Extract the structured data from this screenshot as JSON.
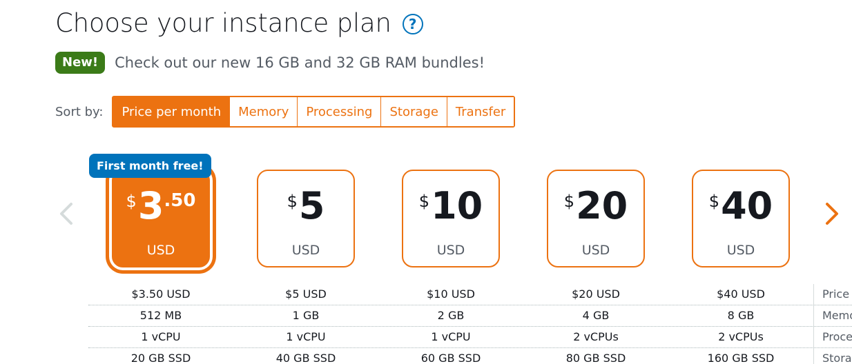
{
  "header": {
    "title": "Choose your instance plan",
    "help_icon": "question-circle-icon"
  },
  "announcement": {
    "badge": "New!",
    "text": "Check out our new 16 GB and 32 GB RAM bundles!",
    "badge_color": "#3b7b18"
  },
  "sort": {
    "label": "Sort by:",
    "options": [
      "Price per month",
      "Memory",
      "Processing",
      "Storage",
      "Transfer"
    ],
    "active": "Price per month"
  },
  "carousel": {
    "prev_icon": "chevron-left-icon",
    "next_icon": "chevron-right-icon",
    "free_tag": "First month free!"
  },
  "plans": [
    {
      "currency": "$",
      "amount": "3",
      "cents": ".50",
      "unit": "USD",
      "selected": true
    },
    {
      "currency": "$",
      "amount": "5",
      "cents": "",
      "unit": "USD",
      "selected": false
    },
    {
      "currency": "$",
      "amount": "10",
      "cents": "",
      "unit": "USD",
      "selected": false
    },
    {
      "currency": "$",
      "amount": "20",
      "cents": "",
      "unit": "USD",
      "selected": false
    },
    {
      "currency": "$",
      "amount": "40",
      "cents": "",
      "unit": "USD",
      "selected": false
    }
  ],
  "specs": {
    "row_labels": [
      "Price",
      "Memo",
      "Proce",
      "Stora"
    ],
    "rows": [
      [
        "$3.50 USD",
        "$5 USD",
        "$10 USD",
        "$20 USD",
        "$40 USD"
      ],
      [
        "512 MB",
        "1 GB",
        "2 GB",
        "4 GB",
        "8 GB"
      ],
      [
        "1 vCPU",
        "1 vCPU",
        "1 vCPU",
        "2 vCPUs",
        "2 vCPUs"
      ],
      [
        "20 GB SSD",
        "40 GB SSD",
        "60 GB SSD",
        "80 GB SSD",
        "160 GB SSD"
      ]
    ]
  },
  "colors": {
    "accent": "#ec7211",
    "link": "#0073bb",
    "text": "#16191f",
    "muted": "#545b64"
  }
}
